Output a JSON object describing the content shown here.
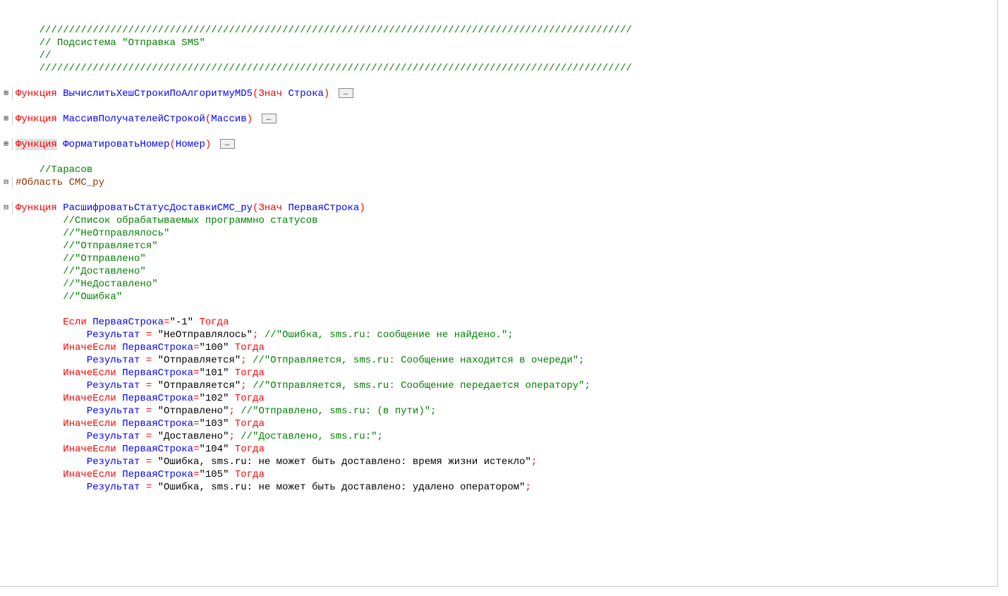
{
  "lines": [
    {
      "gutter": "",
      "indent": 1,
      "tokens": [
        {
          "cls": "comment",
          "text": "////////////////////////////////////////////////////////////////////////////////////////////////////"
        }
      ]
    },
    {
      "gutter": "",
      "indent": 1,
      "tokens": [
        {
          "cls": "comment",
          "text": "// Подсистема \"Отправка SMS\""
        }
      ]
    },
    {
      "gutter": "",
      "indent": 1,
      "tokens": [
        {
          "cls": "comment",
          "text": "//"
        }
      ]
    },
    {
      "gutter": "",
      "indent": 1,
      "tokens": [
        {
          "cls": "comment",
          "text": "////////////////////////////////////////////////////////////////////////////////////////////////////"
        }
      ]
    },
    {
      "gutter": "",
      "indent": 0,
      "tokens": []
    },
    {
      "gutter": "⊞",
      "indent": 0,
      "tokens": [
        {
          "cls": "keyword",
          "text": "Функция "
        },
        {
          "cls": "identifier",
          "text": "ВычислитьХешСтрокиПоАлгоритмуMD5"
        },
        {
          "cls": "open-paren",
          "text": "("
        },
        {
          "cls": "keyword",
          "text": "Знач "
        },
        {
          "cls": "identifier",
          "text": "Строка"
        },
        {
          "cls": "close-paren",
          "text": ")"
        }
      ],
      "folded": true
    },
    {
      "gutter": "",
      "indent": 0,
      "tokens": []
    },
    {
      "gutter": "⊞",
      "indent": 0,
      "tokens": [
        {
          "cls": "keyword",
          "text": "Функция "
        },
        {
          "cls": "identifier",
          "text": "МассивПолучателейСтрокой"
        },
        {
          "cls": "open-paren",
          "text": "("
        },
        {
          "cls": "identifier",
          "text": "Массив"
        },
        {
          "cls": "close-paren",
          "text": ")"
        }
      ],
      "folded": true
    },
    {
      "gutter": "",
      "indent": 0,
      "tokens": []
    },
    {
      "gutter": "⊞",
      "indent": 0,
      "tokens": [
        {
          "cls": "keyword hl",
          "text": "Функция"
        },
        {
          "cls": "keyword",
          "text": " "
        },
        {
          "cls": "identifier",
          "text": "ФорматироватьНомер"
        },
        {
          "cls": "open-paren",
          "text": "("
        },
        {
          "cls": "identifier",
          "text": "Номер"
        },
        {
          "cls": "close-paren",
          "text": ")"
        }
      ],
      "folded": true
    },
    {
      "gutter": "",
      "indent": 0,
      "tokens": []
    },
    {
      "gutter": "",
      "indent": 1,
      "tokens": [
        {
          "cls": "comment",
          "text": "//Тарасов"
        }
      ]
    },
    {
      "gutter": "⊟",
      "indent": 0,
      "tokens": [
        {
          "cls": "preprocessor",
          "text": "#Область СМС_ру"
        }
      ]
    },
    {
      "gutter": "",
      "indent": 0,
      "tokens": []
    },
    {
      "gutter": "⊟",
      "indent": 0,
      "tokens": [
        {
          "cls": "keyword",
          "text": "Функция "
        },
        {
          "cls": "identifier",
          "text": "РасшифроватьСтатусДоставкиСМС_ру"
        },
        {
          "cls": "open-paren",
          "text": "("
        },
        {
          "cls": "keyword",
          "text": "Знач "
        },
        {
          "cls": "identifier",
          "text": "ПерваяСтрока"
        },
        {
          "cls": "close-paren",
          "text": ")"
        }
      ]
    },
    {
      "gutter": "│",
      "indent": 2,
      "tokens": [
        {
          "cls": "comment",
          "text": "//Список обрабатываемых программно статусов"
        }
      ]
    },
    {
      "gutter": "│",
      "indent": 2,
      "tokens": [
        {
          "cls": "comment",
          "text": "//\"НеОтправлялось\""
        }
      ]
    },
    {
      "gutter": "│",
      "indent": 2,
      "tokens": [
        {
          "cls": "comment",
          "text": "//\"Отправляется\""
        }
      ]
    },
    {
      "gutter": "│",
      "indent": 2,
      "tokens": [
        {
          "cls": "comment",
          "text": "//\"Отправлено\""
        }
      ]
    },
    {
      "gutter": "│",
      "indent": 2,
      "tokens": [
        {
          "cls": "comment",
          "text": "//\"Доставлено\""
        }
      ]
    },
    {
      "gutter": "│",
      "indent": 2,
      "tokens": [
        {
          "cls": "comment",
          "text": "//\"НеДоставлено\""
        }
      ]
    },
    {
      "gutter": "│",
      "indent": 2,
      "tokens": [
        {
          "cls": "comment",
          "text": "//\"Ошибка\""
        }
      ]
    },
    {
      "gutter": "│",
      "indent": 2,
      "tokens": []
    },
    {
      "gutter": "│",
      "indent": 2,
      "tokens": [
        {
          "cls": "keyword",
          "text": "Если "
        },
        {
          "cls": "identifier",
          "text": "ПерваяСтрока"
        },
        {
          "cls": "operator",
          "text": "="
        },
        {
          "cls": "string",
          "text": "\"-1\""
        },
        {
          "cls": "keyword",
          "text": " Тогда"
        }
      ]
    },
    {
      "gutter": "│",
      "indent": 3,
      "tokens": [
        {
          "cls": "identifier",
          "text": "Результат "
        },
        {
          "cls": "operator",
          "text": "="
        },
        {
          "cls": "string",
          "text": " \"НеОтправлялось\""
        },
        {
          "cls": "operator",
          "text": ";"
        },
        {
          "cls": "comment",
          "text": " //\"Ошибка, sms.ru: сообщение не найдено.\";"
        }
      ]
    },
    {
      "gutter": "│",
      "indent": 2,
      "tokens": [
        {
          "cls": "keyword",
          "text": "ИначеЕсли "
        },
        {
          "cls": "identifier",
          "text": "ПерваяСтрока"
        },
        {
          "cls": "operator",
          "text": "="
        },
        {
          "cls": "string",
          "text": "\"100\""
        },
        {
          "cls": "keyword",
          "text": " Тогда"
        }
      ]
    },
    {
      "gutter": "│",
      "indent": 3,
      "tokens": [
        {
          "cls": "identifier",
          "text": "Результат "
        },
        {
          "cls": "operator",
          "text": "="
        },
        {
          "cls": "string",
          "text": " \"Отправляется\""
        },
        {
          "cls": "operator",
          "text": ";"
        },
        {
          "cls": "comment",
          "text": " //\"Отправляется, sms.ru: Сообщение находится в очереди\";"
        }
      ]
    },
    {
      "gutter": "│",
      "indent": 2,
      "tokens": [
        {
          "cls": "keyword",
          "text": "ИначеЕсли "
        },
        {
          "cls": "identifier",
          "text": "ПерваяСтрока"
        },
        {
          "cls": "operator",
          "text": "="
        },
        {
          "cls": "string",
          "text": "\"101\""
        },
        {
          "cls": "keyword",
          "text": " Тогда"
        }
      ]
    },
    {
      "gutter": "│",
      "indent": 3,
      "tokens": [
        {
          "cls": "identifier",
          "text": "Результат "
        },
        {
          "cls": "operator",
          "text": "="
        },
        {
          "cls": "string",
          "text": " \"Отправляется\""
        },
        {
          "cls": "operator",
          "text": ";"
        },
        {
          "cls": "comment",
          "text": " //\"Отправляется, sms.ru: Сообщение передается оператору\";"
        }
      ]
    },
    {
      "gutter": "│",
      "indent": 2,
      "tokens": [
        {
          "cls": "keyword",
          "text": "ИначеЕсли "
        },
        {
          "cls": "identifier",
          "text": "ПерваяСтрока"
        },
        {
          "cls": "operator",
          "text": "="
        },
        {
          "cls": "string",
          "text": "\"102\""
        },
        {
          "cls": "keyword",
          "text": " Тогда"
        }
      ]
    },
    {
      "gutter": "│",
      "indent": 3,
      "tokens": [
        {
          "cls": "identifier",
          "text": "Результат "
        },
        {
          "cls": "operator",
          "text": "="
        },
        {
          "cls": "string",
          "text": " \"Отправлено\""
        },
        {
          "cls": "operator",
          "text": ";"
        },
        {
          "cls": "comment",
          "text": " //\"Отправлено, sms.ru: (в пути)\";"
        }
      ]
    },
    {
      "gutter": "│",
      "indent": 2,
      "tokens": [
        {
          "cls": "keyword",
          "text": "ИначеЕсли "
        },
        {
          "cls": "identifier",
          "text": "ПерваяСтрока"
        },
        {
          "cls": "operator",
          "text": "="
        },
        {
          "cls": "string",
          "text": "\"103\""
        },
        {
          "cls": "keyword",
          "text": " Тогда"
        }
      ]
    },
    {
      "gutter": "│",
      "indent": 3,
      "tokens": [
        {
          "cls": "identifier",
          "text": "Результат "
        },
        {
          "cls": "operator",
          "text": "="
        },
        {
          "cls": "string",
          "text": " \"Доставлено\""
        },
        {
          "cls": "operator",
          "text": ";"
        },
        {
          "cls": "comment",
          "text": " //\"Доставлено, sms.ru:\";"
        }
      ]
    },
    {
      "gutter": "│",
      "indent": 2,
      "tokens": [
        {
          "cls": "keyword",
          "text": "ИначеЕсли "
        },
        {
          "cls": "identifier",
          "text": "ПерваяСтрока"
        },
        {
          "cls": "operator",
          "text": "="
        },
        {
          "cls": "string",
          "text": "\"104\""
        },
        {
          "cls": "keyword",
          "text": " Тогда"
        }
      ]
    },
    {
      "gutter": "│",
      "indent": 3,
      "tokens": [
        {
          "cls": "identifier",
          "text": "Результат "
        },
        {
          "cls": "operator",
          "text": "="
        },
        {
          "cls": "string",
          "text": " \"Ошибка, sms.ru: не может быть доставлено: время жизни истекло\""
        },
        {
          "cls": "operator",
          "text": ";"
        }
      ]
    },
    {
      "gutter": "│",
      "indent": 2,
      "tokens": [
        {
          "cls": "keyword",
          "text": "ИначеЕсли "
        },
        {
          "cls": "identifier",
          "text": "ПерваяСтрока"
        },
        {
          "cls": "operator",
          "text": "="
        },
        {
          "cls": "string",
          "text": "\"105\""
        },
        {
          "cls": "keyword",
          "text": " Тогда"
        }
      ]
    },
    {
      "gutter": "│",
      "indent": 3,
      "tokens": [
        {
          "cls": "identifier",
          "text": "Результат "
        },
        {
          "cls": "operator",
          "text": "="
        },
        {
          "cls": "string",
          "text": " \"Ошибка, sms.ru: не может быть доставлено: удалено оператором\""
        },
        {
          "cls": "operator",
          "text": ";"
        }
      ]
    }
  ],
  "fold_marker": "…",
  "indent_unit": "    "
}
